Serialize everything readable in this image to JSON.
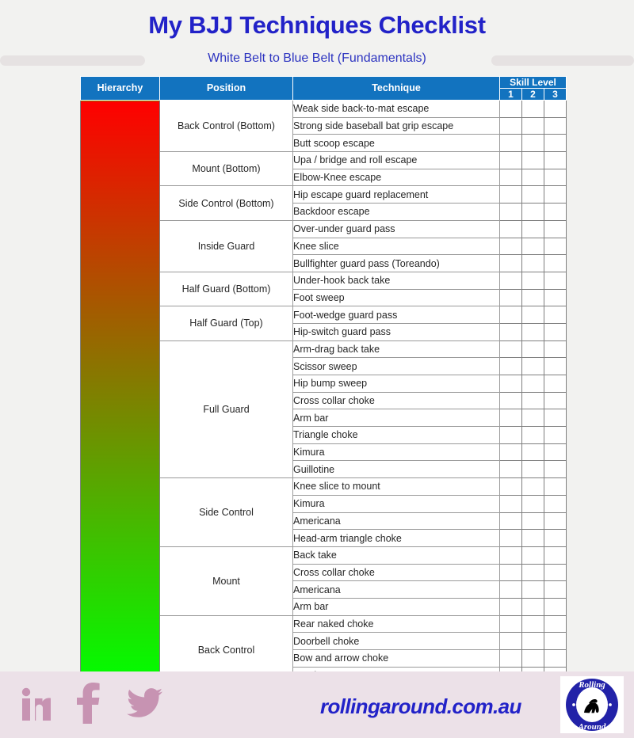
{
  "header": {
    "title": "My BJJ Techniques Checklist",
    "subtitle": "White Belt to Blue Belt (Fundamentals)",
    "title_color": "#2222c8"
  },
  "table": {
    "columns": {
      "hierarchy": "Hierarchy",
      "position": "Position",
      "technique": "Technique",
      "skill_level_group": "Skill Level",
      "skill_levels": [
        "1",
        "2",
        "3"
      ]
    },
    "header_bg": "#1273bf",
    "hierarchy_gradient": {
      "top_color": "#ff0000",
      "bottom_color": "#00ff00"
    },
    "groups": [
      {
        "position": "Back Control (Bottom)",
        "techniques": [
          "Weak side back-to-mat escape",
          "Strong side baseball bat grip escape",
          "Butt scoop escape"
        ]
      },
      {
        "position": "Mount (Bottom)",
        "techniques": [
          "Upa / bridge and roll escape",
          "Elbow-Knee escape"
        ]
      },
      {
        "position": "Side Control (Bottom)",
        "techniques": [
          "Hip escape guard replacement",
          "Backdoor escape"
        ]
      },
      {
        "position": "Inside Guard",
        "techniques": [
          "Over-under guard pass",
          "Knee slice",
          "Bullfighter guard pass (Toreando)"
        ]
      },
      {
        "position": "Half Guard (Bottom)",
        "techniques": [
          "Under-hook back take",
          "Foot sweep"
        ]
      },
      {
        "position": "Half Guard (Top)",
        "techniques": [
          "Foot-wedge guard pass",
          "Hip-switch guard pass"
        ]
      },
      {
        "position": "Full Guard",
        "techniques": [
          "Arm-drag back take",
          "Scissor sweep",
          "Hip bump sweep",
          "Cross collar choke",
          "Arm bar",
          "Triangle choke",
          "Kimura",
          "Guillotine"
        ]
      },
      {
        "position": "Side Control",
        "techniques": [
          "Knee slice to mount",
          "Kimura",
          "Americana",
          "Head-arm triangle choke"
        ]
      },
      {
        "position": "Mount",
        "techniques": [
          "Back take",
          "Cross collar choke",
          "Americana",
          "Arm bar"
        ]
      },
      {
        "position": "Back Control",
        "techniques": [
          "Rear naked choke",
          "Doorbell choke",
          "Bow and arrow choke",
          "Arm bar"
        ]
      }
    ]
  },
  "footer": {
    "site_url": "rollingaround.com.au",
    "social": [
      {
        "name": "linkedin-icon",
        "label": "in"
      },
      {
        "name": "facebook-icon",
        "label": "f"
      },
      {
        "name": "twitter-icon",
        "label": "twitter-bird"
      }
    ],
    "logo": {
      "top_text": "Rolling",
      "bottom_text": "Around"
    },
    "background": "#ece1e8",
    "icon_color": "#c793b2"
  }
}
